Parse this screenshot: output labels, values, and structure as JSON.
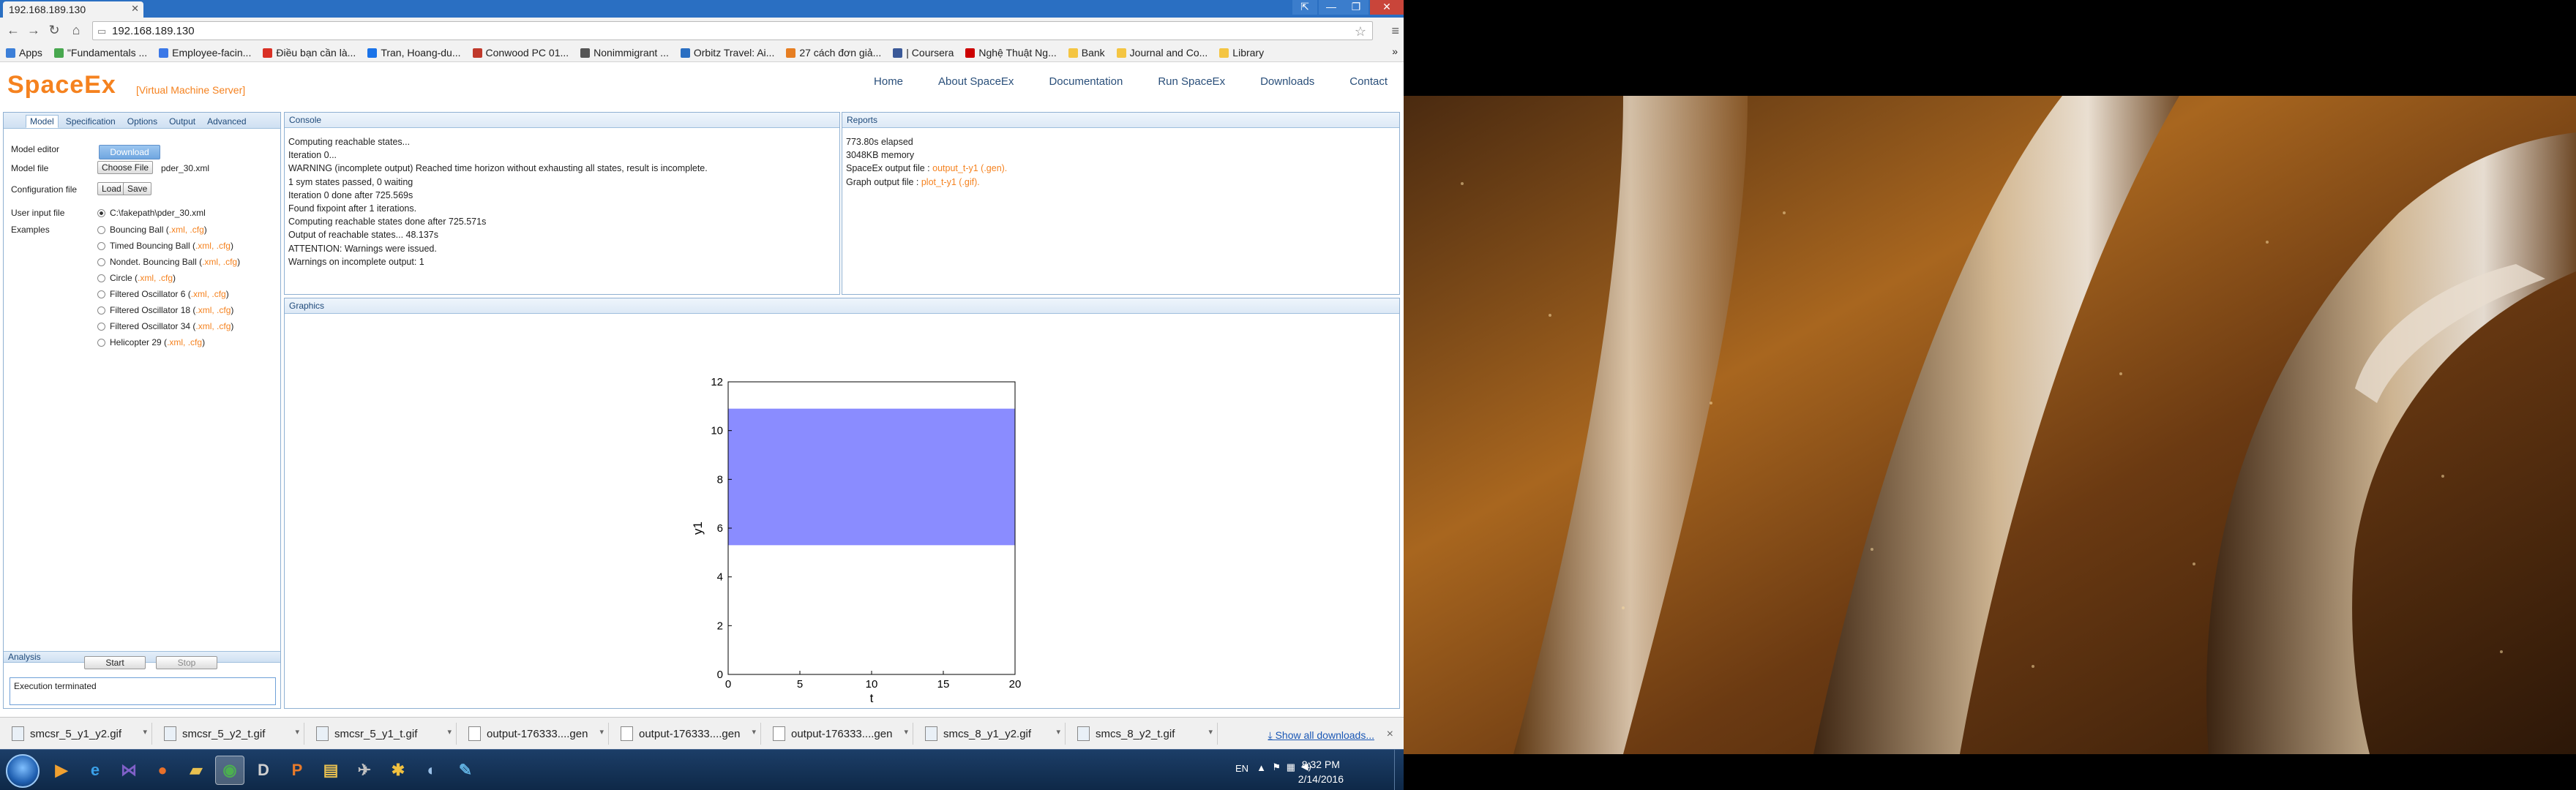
{
  "browser": {
    "tab_title": "192.168.189.130",
    "url": "192.168.189.130",
    "window_buttons": [
      "⇱",
      "—",
      "❐",
      "✕"
    ],
    "bookmarks": [
      {
        "label": "Apps",
        "color": "#3c7fd8"
      },
      {
        "label": "\"Fundamentals ...",
        "color": "#48a84f"
      },
      {
        "label": "Employee-facin...",
        "color": "#3b78e7"
      },
      {
        "label": "Điều bạn cần là...",
        "color": "#d93025"
      },
      {
        "label": "Tran, Hoang-du...",
        "color": "#1a73e8"
      },
      {
        "label": "Conwood PC 01...",
        "color": "#c0392b"
      },
      {
        "label": "Nonimmigrant ...",
        "color": "#555555"
      },
      {
        "label": "Orbitz Travel: Ai...",
        "color": "#2a6fc2"
      },
      {
        "label": "27 cách đơn giả...",
        "color": "#e67e22"
      },
      {
        "label": "| Coursera",
        "color": "#3b5998"
      },
      {
        "label": "Nghệ Thuật Ng...",
        "color": "#cc0000"
      },
      {
        "label": "Bank",
        "color": "#f4c542"
      },
      {
        "label": "Journal and Co...",
        "color": "#f4c542"
      },
      {
        "label": "Library",
        "color": "#f4c542"
      }
    ],
    "bookmarks_more": "»"
  },
  "site": {
    "brand": "SpaceEx",
    "brand_sub": "[Virtual Machine Server]",
    "nav": [
      "Home",
      "About SpaceEx",
      "Documentation",
      "Run SpaceEx",
      "Downloads",
      "Contact"
    ]
  },
  "left": {
    "tabs": [
      "Model",
      "Specification",
      "Options",
      "Output",
      "Advanced"
    ],
    "model_editor_label": "Model editor",
    "download_btn": "Download",
    "model_file_label": "Model file",
    "choose_file_btn": "Choose File",
    "model_file_name": "pder_30.xml",
    "config_file_label": "Configuration file",
    "load_btn": "Load",
    "save_btn": "Save",
    "user_input_label": "User input file",
    "user_input_path": "C:\\fakepath\\pder_30.xml",
    "examples_label": "Examples",
    "examples": [
      {
        "name": "Bouncing Ball",
        "links": ".xml, .cfg"
      },
      {
        "name": "Timed Bouncing Ball",
        "links": ".xml, .cfg"
      },
      {
        "name": "Nondet. Bouncing Ball",
        "links": ".xml, .cfg"
      },
      {
        "name": "Circle",
        "links": ".xml, .cfg"
      },
      {
        "name": "Filtered Oscillator 6",
        "links": ".xml, .cfg"
      },
      {
        "name": "Filtered Oscillator 18",
        "links": ".xml, .cfg"
      },
      {
        "name": "Filtered Oscillator 34",
        "links": ".xml, .cfg"
      },
      {
        "name": "Helicopter 29",
        "links": ".xml, .cfg"
      }
    ],
    "analysis_label": "Analysis",
    "start_btn": "Start",
    "stop_btn": "Stop",
    "status": "Execution terminated"
  },
  "console": {
    "title": "Console",
    "lines": [
      "Computing reachable states...",
      "Iteration 0...",
      "WARNING (incomplete output) Reached time horizon without exhausting all states, result is incomplete.",
      "1 sym states passed, 0 waiting",
      "Iteration 0 done after 725.569s",
      "Found fixpoint after 1 iterations.",
      "Computing reachable states done after 725.571s",
      "Output of reachable states... 48.137s",
      "ATTENTION: Warnings were issued.",
      "Warnings on incomplete output: 1"
    ]
  },
  "reports": {
    "title": "Reports",
    "elapsed": "773.80s elapsed",
    "memory": "3048KB memory",
    "spaceex_output_label": "SpaceEx output file :",
    "spaceex_output_link": "output_t-y1 (.gen).",
    "graph_output_label": "Graph output file :",
    "graph_output_link": "plot_t-y1 (.gif)."
  },
  "graphics": {
    "title": "Graphics"
  },
  "chart_data": {
    "type": "area",
    "title": "",
    "xlabel": "t",
    "ylabel": "y1",
    "xlim": [
      0,
      20
    ],
    "ylim": [
      0,
      12
    ],
    "xticks": [
      0,
      5,
      10,
      15,
      20
    ],
    "yticks": [
      0,
      2,
      4,
      6,
      8,
      10,
      12
    ],
    "region": {
      "x": [
        0,
        20
      ],
      "y": [
        5.3,
        10.9
      ]
    },
    "fill_color": "#8a8cff"
  },
  "downloads": {
    "items": [
      "smcsr_5_y1_y2.gif",
      "smcsr_5_y2_t.gif",
      "smcsr_5_y1_t.gif",
      "output-176333....gen",
      "output-176333....gen",
      "output-176333....gen",
      "smcs_8_y1_y2.gif",
      "smcs_8_y2_t.gif"
    ],
    "show_all": "Show all downloads...",
    "close": "×"
  },
  "taskbar": {
    "lang": "EN",
    "time": "8:32 PM",
    "date": "2/14/2016",
    "apps": [
      {
        "name": "media-player",
        "glyph": "▶",
        "color": "#f0a030"
      },
      {
        "name": "internet-explorer",
        "glyph": "e",
        "color": "#3aa0e8"
      },
      {
        "name": "visual-studio",
        "glyph": "⋈",
        "color": "#8060c8"
      },
      {
        "name": "firefox",
        "glyph": "●",
        "color": "#e8702a"
      },
      {
        "name": "file-explorer",
        "glyph": "▰",
        "color": "#e8c050"
      },
      {
        "name": "chrome",
        "glyph": "◉",
        "color": "#4caf50"
      },
      {
        "name": "dxg-tool",
        "glyph": "D",
        "color": "#d0d0d0"
      },
      {
        "name": "pdf-tool",
        "glyph": "P",
        "color": "#e87a2a"
      },
      {
        "name": "folders",
        "glyph": "▤",
        "color": "#e8c050"
      },
      {
        "name": "vm-tool",
        "glyph": "✈",
        "color": "#c0c0c0"
      },
      {
        "name": "network-tool",
        "glyph": "✱",
        "color": "#f0c040"
      },
      {
        "name": "remote-tool",
        "glyph": "◐",
        "color": "#9ac0e8"
      },
      {
        "name": "paint-tool",
        "glyph": "✎",
        "color": "#60b0e0"
      }
    ]
  }
}
